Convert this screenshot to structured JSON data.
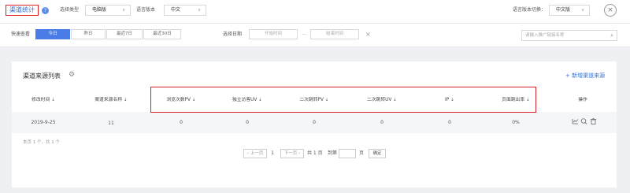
{
  "header": {
    "title": "渠道统计",
    "help_icon": "?",
    "type_label": "选择类型",
    "type_value": "电脑版",
    "lang_label": "语言版本",
    "lang_value": "中文",
    "switch_label": "语言版本切换：",
    "switch_value": "中文版",
    "close_icon": "×"
  },
  "filters": {
    "quick_label": "快速查看",
    "quick_options": [
      "今日",
      "昨日",
      "最近7日",
      "最近30日"
    ],
    "date_label": "选择日期",
    "start_placeholder": "开始时间",
    "range_sep": "—",
    "end_placeholder": "结束时间",
    "clear_icon": "×",
    "search_placeholder": "请输入推广链接名称"
  },
  "panel": {
    "title": "渠道来源列表",
    "add_label": "+ 新增渠道来源",
    "columns": [
      "修改时间 ⇣",
      "渠道来源名称 ⇣",
      "浏览次数PV ⇣",
      "独立访客UV ⇣",
      "二次跳转PV ⇣",
      "二次跳转UV ⇣",
      "IP ⇣",
      "页面跳出率 ⇣",
      "操作"
    ],
    "rows": [
      {
        "cells": [
          "2019-9-25",
          "11",
          "0",
          "0",
          "0",
          "0",
          "0",
          "0%"
        ]
      }
    ]
  },
  "pagination": {
    "summary": "本页 1 个，共 1 个",
    "prev": "‹ 上一页",
    "page": "1",
    "next": "下一页 ›",
    "total": "共 1 页",
    "goto_label": "到第",
    "page_suffix": "页",
    "confirm": "确定"
  }
}
